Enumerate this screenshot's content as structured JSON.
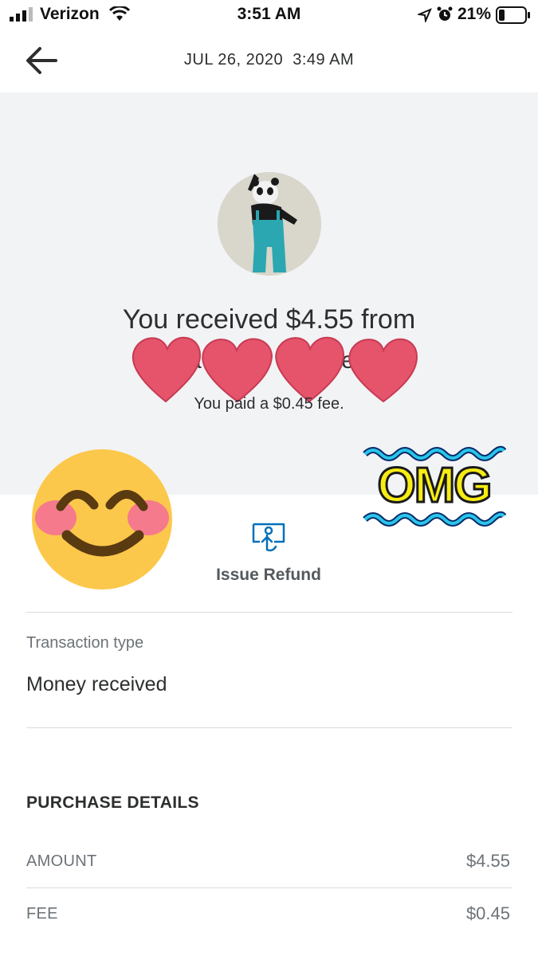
{
  "status_bar": {
    "carrier": "Verizon",
    "time": "3:51 AM",
    "battery_percent": "21%",
    "icons": [
      "signal-icon",
      "wifi-icon",
      "location-icon",
      "alarm-icon",
      "battery-icon"
    ]
  },
  "header": {
    "back_icon": "arrow-left-icon",
    "datetime": "JUL 26, 2020  3:49 AM"
  },
  "summary": {
    "received_text": "You received $4.55 from",
    "name_fragments": [
      "a",
      "e"
    ],
    "fee_text": "You paid a $0.45 fee."
  },
  "stickers": {
    "omg_text": "OMG",
    "heart_color": "#e5546a",
    "smiley_color": "#fcc84b"
  },
  "actions": {
    "issue_refund_label": "Issue Refund",
    "refund_icon": "refund-icon",
    "accent_color": "#0070ba"
  },
  "transaction": {
    "type_label": "Transaction type",
    "type_value": "Money received"
  },
  "purchase_details": {
    "title": "PURCHASE DETAILS",
    "rows": [
      {
        "label": "AMOUNT",
        "value": "$4.55"
      },
      {
        "label": "FEE",
        "value": "$0.45"
      }
    ]
  }
}
